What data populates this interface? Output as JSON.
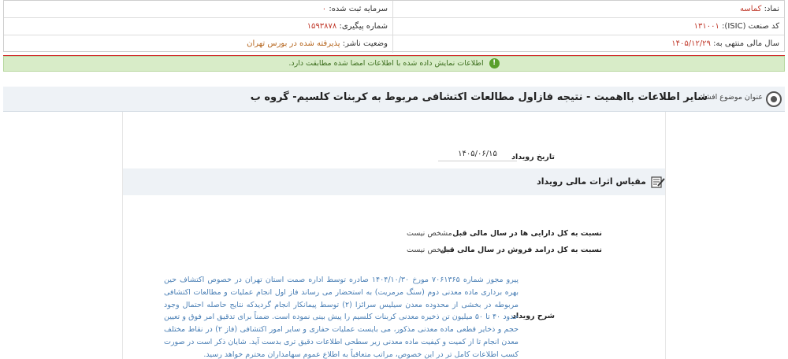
{
  "info": {
    "symbol_label": "نماد:",
    "symbol_value": "کماسه",
    "registered_capital_label": "سرمایه ثبت شده:",
    "registered_capital_value": "۰",
    "isic_label": "کد صنعت (ISIC):",
    "isic_value": "۱۳۱۰۰۱",
    "tracking_label": "شماره پیگیری:",
    "tracking_value": "۱۵۹۳۸۷۸",
    "fiscal_year_label": "سال مالی منتهی به:",
    "fiscal_year_value": "۱۴۰۵/۱۲/۲۹",
    "publisher_status_label": "وضعیت ناشر:",
    "publisher_status_value": "پذیرفته شده در بورس تهران"
  },
  "notice": {
    "text": "اطلاعات نمایش داده شده با اطلاعات امضا شده مطابقت دارد.",
    "icon": "info-icon"
  },
  "subject": {
    "label": "عنوان موضوع افشا:",
    "text": "سایر اطلاعات بااهمیت - نتیجه فازاول مطالعات اکتشافی مربوط به کربنات کلسیم- گروه ب"
  },
  "event": {
    "date_label": "تاریخ رویداد",
    "date_value": "۱۴۰۵/۰۶/۱۵",
    "financial_header": "مقیاس اثرات مالی رویداد",
    "ratios": [
      {
        "label": "نسبت به کل دارایی ها در سال مالی قبل",
        "value": "مشخص نیست"
      },
      {
        "label": "نسبت به کل درامد فروش در سال مالی قبل",
        "value": "مشخص نیست"
      }
    ],
    "description_label": "شرح رویداد",
    "description": "پیرو مجوز شماره ۷۰۶۱۳۶۵ مورخ ۱۴۰۴/۱۰/۳۰ صادره توسط اداره صمت استان تهران در خصوص اکتشاف حین بهره برداری ماده معدنی دوم (سنگ مرمریت) به استحضار می رساند فاز اول انجام عملیات و مطالعات اکتشافی مربوطه در بخشی از محدوده معدن سیلیس سرائزا (۲) توسط پیمانکار انجام گردیدکه نتایج حاصله احتمال وجود حدود ۴۰ تا ۵۰ میلیون تن ذخیره معدنی کربنات کلسیم را پیش بینی نموده است. ضمناً برای تدقیق امر فوق و تعیین حجم و ذخایر قطعی ماده معدنی مذکور، می بایست عملیات حفاری و سایر امور اکتشافی (فاز ۲) در نقاط مختلف معدن انجام تا از کمیت و کیفیت ماده معدنی زیر سطحی اطلاعات دقیق تری بدست آید. شایان ذکر است در صورت کسب اطلاعات کامل تر در این خصوص، مراتب متعاقباً به اطلاع عموم سهامداران محترم خواهد رسید."
  },
  "colors": {
    "accent_red": "#d32f2f",
    "notice_bg": "#d8ecc8",
    "link_blue": "#4a7fb5"
  }
}
